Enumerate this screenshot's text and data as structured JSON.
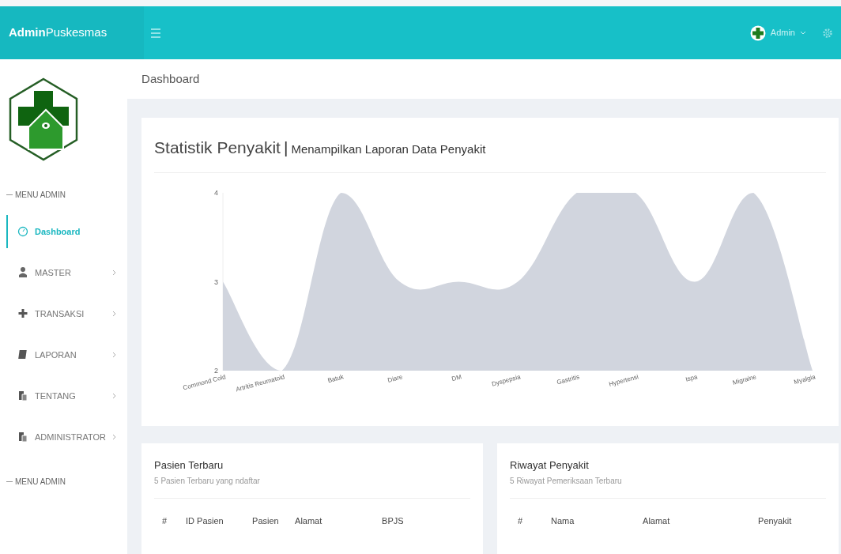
{
  "brand": {
    "bold": "Admin",
    "rest": "Puskesmas"
  },
  "topbar": {
    "user": "Admin"
  },
  "breadcrumb": "Dashboard",
  "sidebar": {
    "sections": [
      {
        "heading": "MENU ADMIN",
        "items": [
          {
            "label": "Dashboard",
            "selected": true,
            "expandable": false
          },
          {
            "label": "MASTER",
            "selected": false,
            "expandable": true
          },
          {
            "label": "TRANSAKSI",
            "selected": false,
            "expandable": true
          },
          {
            "label": "LAPORAN",
            "selected": false,
            "expandable": true
          },
          {
            "label": "TENTANG",
            "selected": false,
            "expandable": true
          },
          {
            "label": "ADMINISTRATOR",
            "selected": false,
            "expandable": true
          }
        ]
      },
      {
        "heading": "MENU ADMIN"
      }
    ]
  },
  "chart_card": {
    "title": "Statistik Penyakit",
    "separator": "|",
    "subtitle": "Menampilkan Laporan Data Penyakit",
    "chart_data": {
      "type": "area",
      "categories": [
        "Commond Cold",
        "Artritis Reumatoid",
        "Batuk",
        "Diare",
        "DM",
        "Dyspepsia",
        "Gastritis",
        "Hypertensi",
        "Ispa",
        "Migraine",
        "Myalgia"
      ],
      "series": [
        {
          "color": "#d1d5de",
          "values": [
            3,
            2,
            4,
            3,
            3,
            3,
            4,
            4,
            3,
            4,
            2
          ]
        }
      ],
      "ylim": [
        2,
        4
      ],
      "yticks": [
        2,
        3,
        4
      ]
    }
  },
  "tables": [
    {
      "title": "Pasien Terbaru",
      "subtitle": "5 Pasien Terbaru yang ndaftar",
      "columns": [
        "#",
        "ID Pasien",
        "Pasien",
        "Alamat",
        "BPJS"
      ]
    },
    {
      "title": "Riwayat Penyakit",
      "subtitle": "5 Riwayat Pemeriksaan Terbaru",
      "columns": [
        "#",
        "Nama",
        "Alamat",
        "Penyakit"
      ]
    }
  ]
}
